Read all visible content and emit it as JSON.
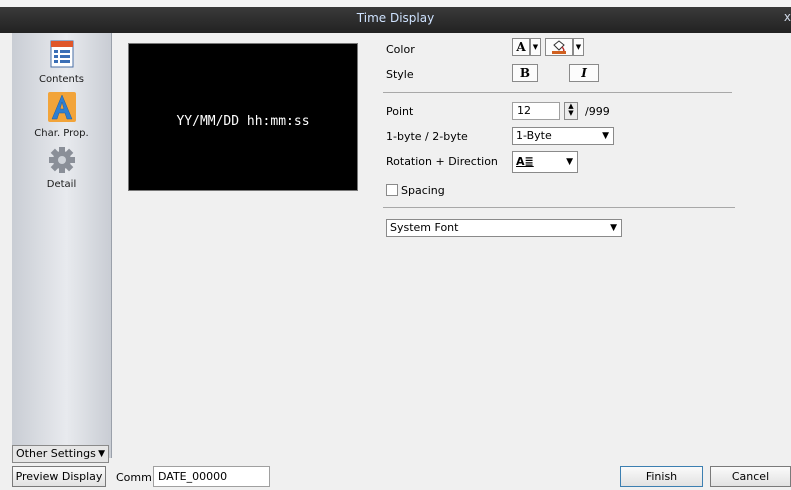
{
  "window": {
    "title": "Time Display",
    "close_glyph": "x"
  },
  "sidebar": {
    "items": [
      {
        "label": "Contents",
        "icon": "contents-icon"
      },
      {
        "label": "Char. Prop.",
        "icon": "char-prop-icon"
      },
      {
        "label": "Detail",
        "icon": "gear-icon"
      }
    ],
    "other_settings": "Other Settings"
  },
  "preview": {
    "text": "YY/MM/DD hh:mm:ss"
  },
  "props": {
    "color_label": "Color",
    "color_text_glyph": "A",
    "style_label": "Style",
    "bold_glyph": "B",
    "italic_glyph": "I",
    "point_label": "Point",
    "point_value": "12",
    "point_max": "/999",
    "byte_label": "1-byte / 2-byte",
    "byte_value": "1-Byte",
    "rotation_label": "Rotation + Direction",
    "rotation_glyph": "A≣",
    "spacing_label": "Spacing",
    "spacing_checked": false,
    "font_value": "System Font"
  },
  "footer": {
    "preview_btn": "Preview Display",
    "comm_label": "Comm",
    "comm_value": "DATE_00000",
    "finish_btn": "Finish",
    "cancel_btn": "Cancel"
  },
  "colors": {
    "title_text": "#cfe3ff",
    "finish_border": "#3c7fb1"
  }
}
